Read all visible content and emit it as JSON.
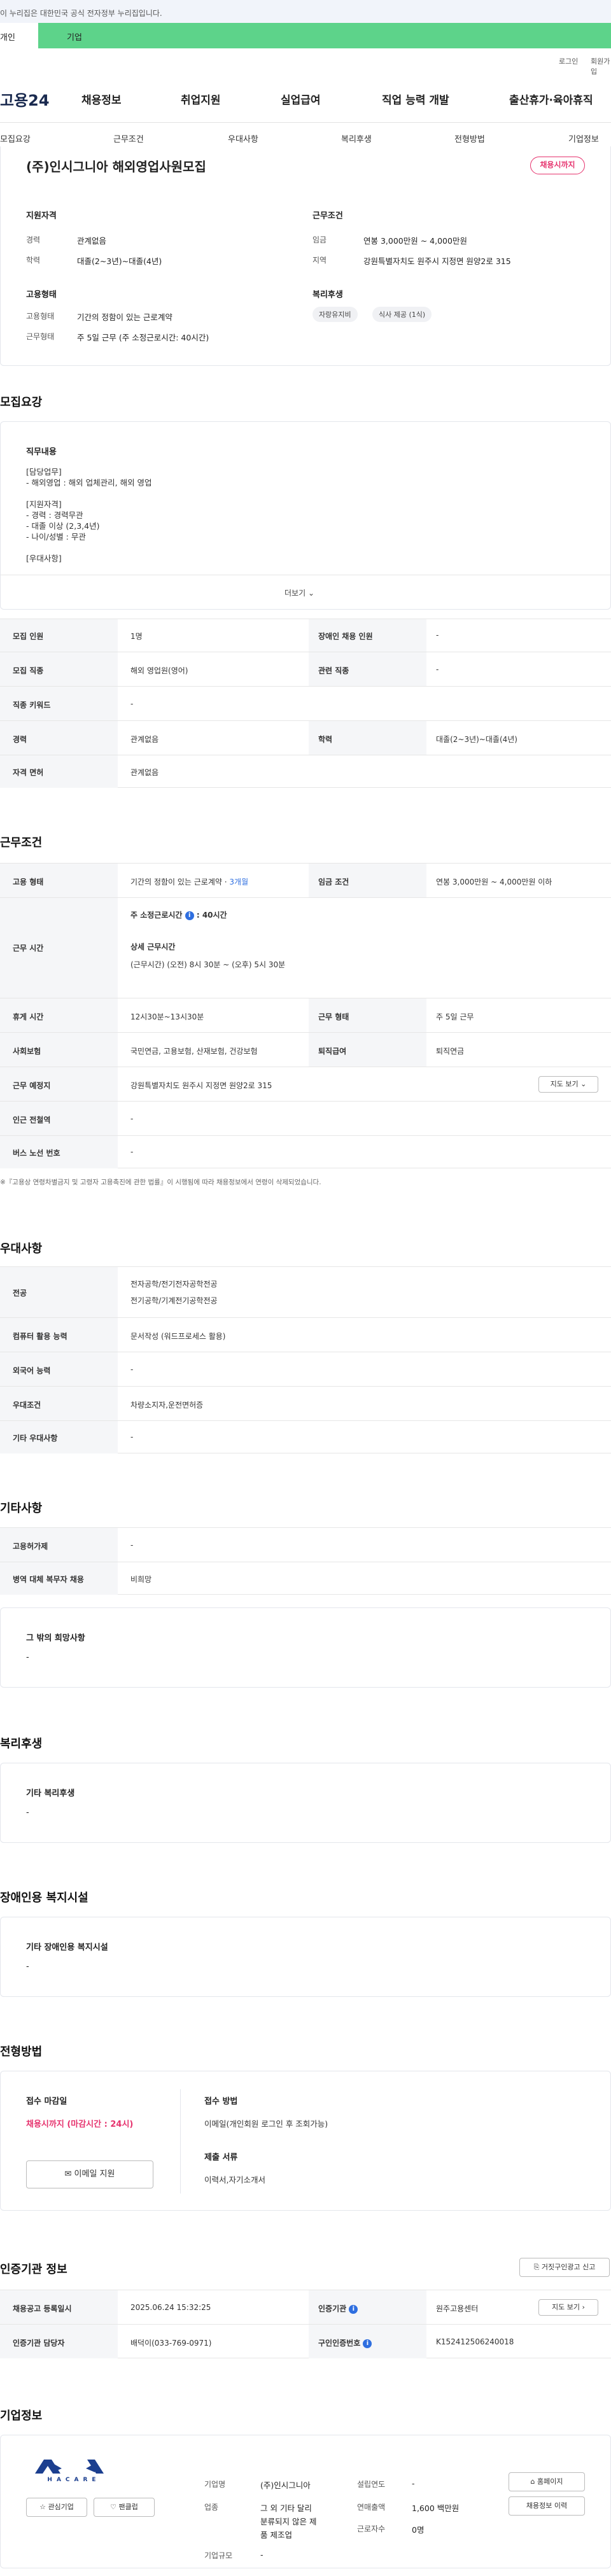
{
  "gov_banner": "이 누리집은 대한민국 공식 전자정부 누리집입니다.",
  "top_tabs": [
    "개인",
    "기업"
  ],
  "util": {
    "login": "로그인",
    "join": "회원가입"
  },
  "logo": "고용24",
  "gnb": [
    "채용정보",
    "취업지원",
    "실업급여",
    "직업 능력 개발",
    "출산휴가·육아휴직"
  ],
  "subnav": [
    "모집요강",
    "근무조건",
    "우대사항",
    "복리후생",
    "전형방법",
    "기업정보"
  ],
  "job": {
    "title": "(주)인시그니아 해외영업사원모집",
    "status": "채용시까지",
    "qual_title": "지원자격",
    "career_l": "경력",
    "career_v": "관계없음",
    "edu_l": "학력",
    "edu_v": "대졸(2~3년)~대졸(4년)",
    "cond_title": "근무조건",
    "wage_l": "임금",
    "wage_v": "연봉 3,000만원 ~ 4,000만원",
    "region_l": "지역",
    "region_v": "강원특별자치도 원주시 지정면 원양2로 315",
    "emp_title": "고용형태",
    "emptype_l": "고용형태",
    "emptype_v": "기간의 정함이 있는 근로계약",
    "worktype_l": "근무형태",
    "worktype_v": "주 5일 근무 (주 소정근로시간: 40시간)",
    "welfare_title": "복리후생",
    "chips": [
      "자랑유지비",
      "식사 제공 (1식)"
    ]
  },
  "recruit": {
    "title": "모집요강",
    "duty_title": "직무내용",
    "duty_lines": [
      "[담당업무]",
      "- 해외영업 : 해외 업체관리, 해외 영업",
      "",
      "[지원자격]",
      "- 경력 : 경력무관",
      "- 대졸 이상 (2,3,4년)",
      "- 나이/성별 : 무관",
      "",
      "[우대사항]"
    ],
    "more": "더보기",
    "rows": [
      [
        "모집 인원",
        "1명",
        "장애인 채용 인원",
        "-"
      ],
      [
        "모집 직종",
        "해외 영업원(영어)",
        "관련 직종",
        "-"
      ],
      [
        "직종 키워드",
        "-"
      ],
      [
        "경력",
        "관계없음",
        "학력",
        "대졸(2~3년)~대졸(4년)"
      ],
      [
        "자격 면허",
        "관계없음"
      ]
    ]
  },
  "work": {
    "title": "근무조건",
    "emp_l": "고용 형태",
    "emp_v": "기간의 정함이 있는 근로계약 ·",
    "emp_v2": "3개월",
    "wage_l": "임금 조건",
    "wage_v": "연봉 3,000만원 ~ 4,000만원 이하",
    "time_l": "근무 시간",
    "time_a": "주 소정근로시간",
    "time_a2": ": 40시간",
    "time_b": "상세 근무시간",
    "time_c": "(근무시간) (오전) 8시 30분 ~ (오후) 5시 30분",
    "rest_l": "휴게 시간",
    "rest_v": "12시30분~13시30분",
    "form_l": "근무 형태",
    "form_v": "주 5일 근무",
    "ins_l": "사회보험",
    "ins_v": "국민연금, 고용보험, 산재보험, 건강보험",
    "ret_l": "퇴직급여",
    "ret_v": "퇴직연금",
    "place_l": "근무 예정지",
    "place_v": "강원특별자치도 원주시 지정면 원양2로 315",
    "map": "지도 보기",
    "sub_l": "인근 전철역",
    "sub_v": "-",
    "bus_l": "버스 노선 번호",
    "bus_v": "-",
    "note": "※『고용상 연령차별금지 및 고령자 고용촉진에 관한 법률』이 시행됨에 따라 채용정보에서 연령이 삭제되었습니다."
  },
  "pref": {
    "title": "우대사항",
    "rows": [
      [
        "전공",
        "전자공학/전기전자공학전공",
        "전기공학/기계전기공학전공"
      ],
      [
        "컴퓨터 활용 능력",
        "문서작성 (워드프로세스 활용)"
      ],
      [
        "외국어 능력",
        "-"
      ],
      [
        "우대조건",
        "차량소지자,운전면허증"
      ],
      [
        "기타 우대사항",
        "-"
      ]
    ]
  },
  "etc": {
    "title": "기타사항",
    "rows": [
      [
        "고용허가제",
        "-"
      ],
      [
        "병역 대체 복무자 채용",
        "비희망"
      ]
    ],
    "card_t": "그 밖의 희망사항",
    "card_v": "-"
  },
  "welfare": {
    "title": "복리후생",
    "card_t": "기타 복리후생",
    "card_v": "-"
  },
  "disab": {
    "title": "장애인용 복지시설",
    "card_t": "기타 장애인용 복지시설",
    "card_v": "-"
  },
  "selection": {
    "title": "전형방법",
    "deadline_t": "접수 마감일",
    "deadline_v": "채용시까지 (마감시간 : 24시)",
    "email_btn": "이메일 지원",
    "method_t": "접수 방법",
    "method_v": "이메일(개인회원 로그인 후 조회가능)",
    "docs_t": "제출 서류",
    "docs_v": "이력서,자기소개서"
  },
  "cert": {
    "title": "인증기관 정보",
    "report": "거짓구인광고 신고",
    "rows": [
      [
        "채용공고 등록일시",
        "2025.06.24 15:32:25",
        "인증기관",
        "원주고용센터"
      ],
      [
        "인증기관 담당자",
        "배덕이(033-769-0971)",
        "구인인증번호",
        "K152412506240018"
      ]
    ],
    "map": "지도 보기"
  },
  "company": {
    "title": "기업정보",
    "logo": "HACARE",
    "fav": "관심기업",
    "fan": "팬클럽",
    "name_l": "기업명",
    "name_v": "(주)인시그니아",
    "ind_l": "업종",
    "ind_v": [
      "그 외 기타 달리",
      "분류되지 않은 제",
      "품 제조업"
    ],
    "scale_l": "기업규모",
    "scale_v": "-",
    "est_l": "설립연도",
    "est_v": "-",
    "rev_l": "연매출액",
    "rev_v": "1,600 백만원",
    "emp_l": "근로자수",
    "emp_v": "0명",
    "home": "홈페이지",
    "history": "채용정보 이력"
  },
  "colors": {
    "accent": "#5dd38a",
    "status": "#e6336e",
    "blue": "#2f6fe0"
  }
}
